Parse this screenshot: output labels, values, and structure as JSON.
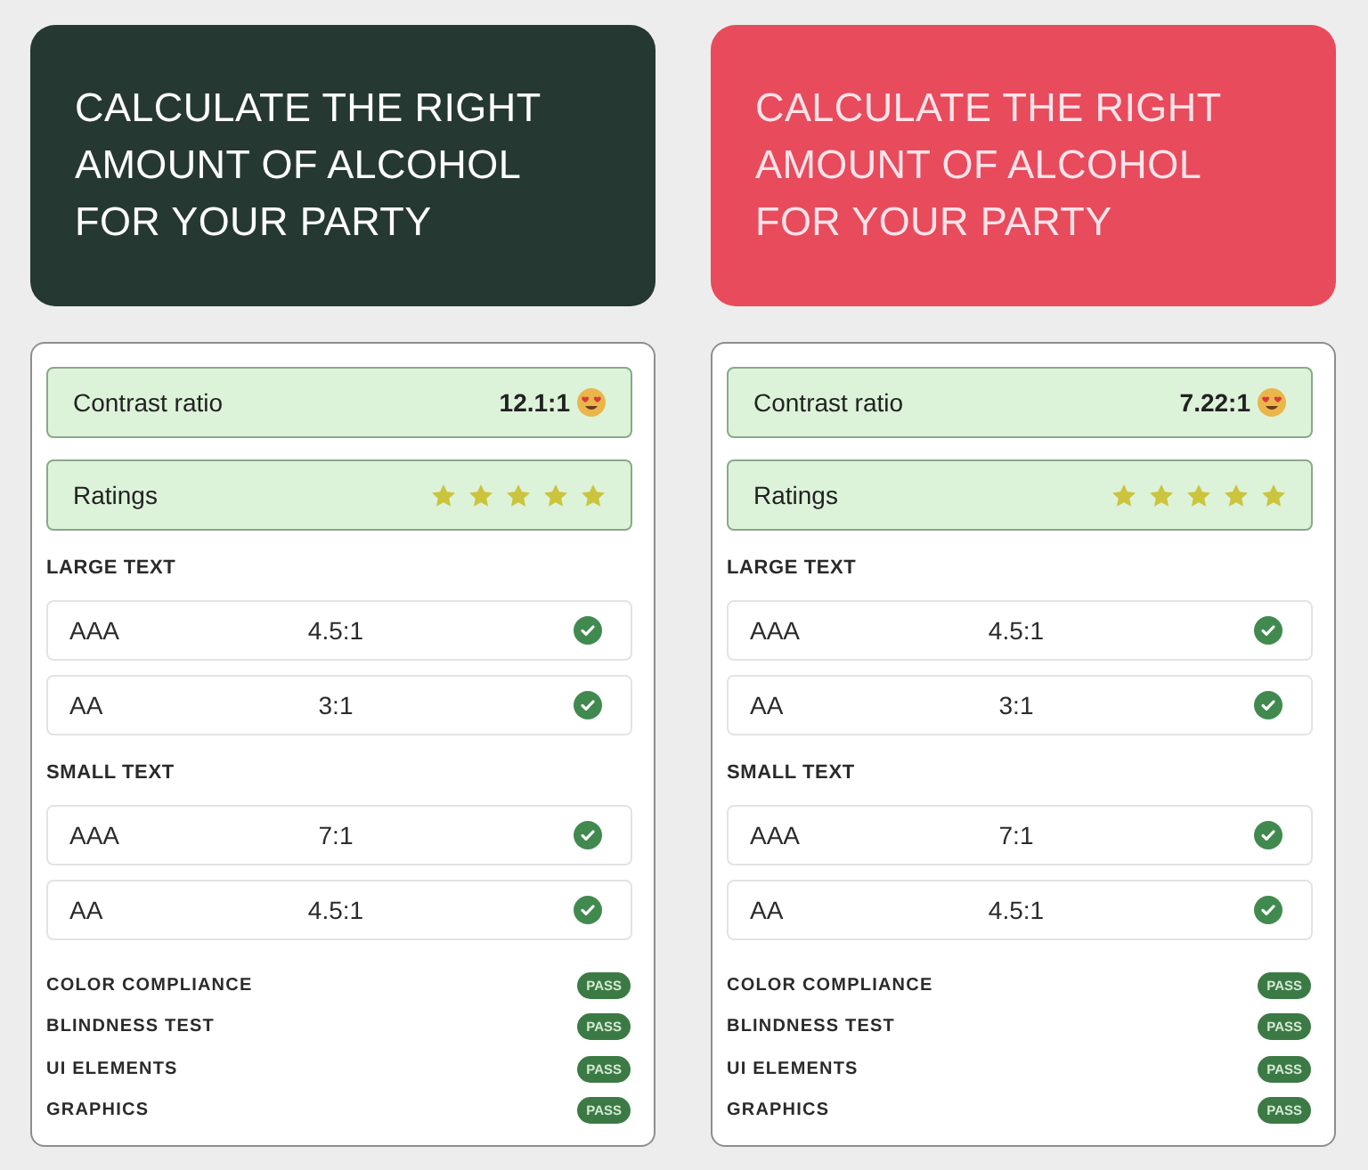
{
  "panels": [
    {
      "title_card": {
        "color": "#253832",
        "title": {
          "text": "CALCULATE THE RIGHT AMOUNT OF ALCOHOL FOR YOUR PARTY",
          "color": "#ffffff"
        }
      },
      "contrast_ratio": {
        "label": "Contrast ratio",
        "value": "12.1:1"
      },
      "ratings": {
        "label": "Ratings",
        "stars": 5
      },
      "sections": [
        {
          "heading": "LARGE TEXT",
          "rows": [
            {
              "grade": "AAA",
              "ratio": "4.5:1",
              "passed": true
            },
            {
              "grade": "AA",
              "ratio": "3:1",
              "passed": true
            }
          ]
        },
        {
          "heading": "SMALL TEXT",
          "rows": [
            {
              "grade": "AAA",
              "ratio": "7:1",
              "passed": true
            },
            {
              "grade": "AA",
              "ratio": "4.5:1",
              "passed": true
            }
          ]
        }
      ],
      "checks": [
        {
          "label": "COLOR COMPLIANCE",
          "badge": "PASS"
        },
        {
          "label": "BLINDNESS TEST",
          "badge": "PASS"
        },
        {
          "label": "UI ELEMENTS",
          "badge": "PASS"
        },
        {
          "label": "GRAPHICS",
          "badge": "PASS"
        }
      ]
    },
    {
      "title_card": {
        "color": "#e84b5b",
        "title": {
          "text": "CALCULATE THE RIGHT AMOUNT OF ALCOHOL FOR YOUR PARTY",
          "color": "#fde3ea"
        }
      },
      "contrast_ratio": {
        "label": "Contrast ratio",
        "value": "7.22:1"
      },
      "ratings": {
        "label": "Ratings",
        "stars": 5
      },
      "sections": [
        {
          "heading": "LARGE TEXT",
          "rows": [
            {
              "grade": "AAA",
              "ratio": "4.5:1",
              "passed": true
            },
            {
              "grade": "AA",
              "ratio": "3:1",
              "passed": true
            }
          ]
        },
        {
          "heading": "SMALL TEXT",
          "rows": [
            {
              "grade": "AAA",
              "ratio": "7:1",
              "passed": true
            },
            {
              "grade": "AA",
              "ratio": "4.5:1",
              "passed": true
            }
          ]
        }
      ],
      "checks": [
        {
          "label": "COLOR COMPLIANCE",
          "badge": "PASS"
        },
        {
          "label": "BLINDNESS TEST",
          "badge": "PASS"
        },
        {
          "label": "UI ELEMENTS",
          "badge": "PASS"
        },
        {
          "label": "GRAPHICS",
          "badge": "PASS"
        }
      ]
    }
  ]
}
